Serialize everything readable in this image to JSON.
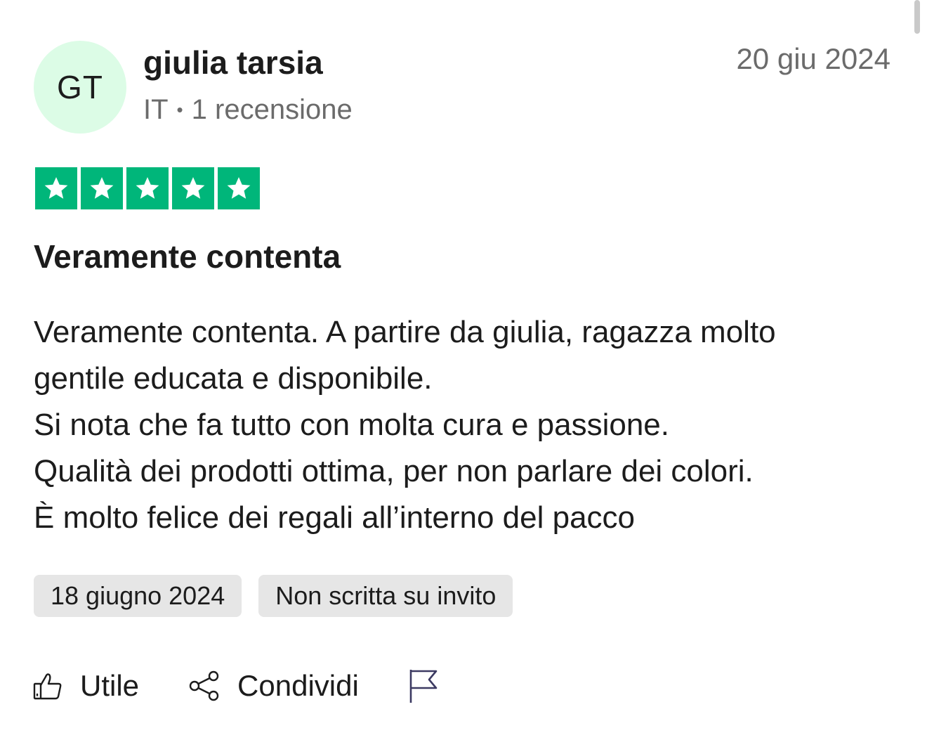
{
  "reviewer": {
    "initials": "GT",
    "name": "giulia tarsia",
    "country": "IT",
    "separator": "•",
    "review_count": "1 recensione"
  },
  "review": {
    "posted_date": "20 giu 2024",
    "rating": 5,
    "rating_color": "#00b67a",
    "title": "Veramente contenta",
    "body_lines": [
      "Veramente contenta. A partire da giulia, ragazza molto",
      "gentile educata e disponibile.",
      "Si nota che fa tutto con molta cura e passione.",
      "Qualità dei prodotti ottima, per non parlare dei colori.",
      "È molto felice dei regali all’interno del pacco"
    ]
  },
  "tags": {
    "experience_date": "18 giugno 2024",
    "invite_status": "Non scritta su invito"
  },
  "actions": {
    "useful_label": "Utile",
    "useful_icon": "thumbs-up-icon",
    "share_label": "Condividi",
    "share_icon": "share-icon",
    "report_icon": "flag-icon"
  }
}
